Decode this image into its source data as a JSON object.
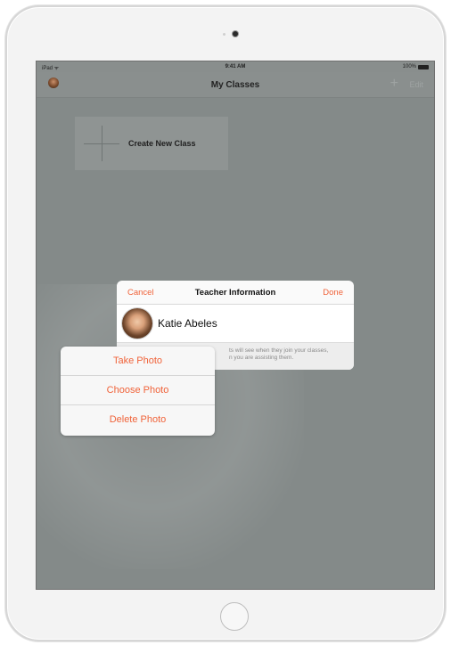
{
  "status_bar": {
    "carrier": "iPad ᯤ",
    "time": "9:41 AM",
    "battery": "100%"
  },
  "nav": {
    "title": "My Classes",
    "add_glyph": "+",
    "edit_label": "Edit"
  },
  "main": {
    "create_class_label": "Create New Class"
  },
  "dialog": {
    "cancel_label": "Cancel",
    "title": "Teacher Information",
    "done_label": "Done",
    "teacher_name": "Katie Abeles",
    "note_line1": "ts will see when they join your classes,",
    "note_line2": "n you are assisting them."
  },
  "action_sheet": {
    "items": [
      {
        "label": "Take Photo"
      },
      {
        "label": "Choose Photo"
      },
      {
        "label": "Delete Photo"
      }
    ]
  },
  "colors": {
    "accent": "#f0633a",
    "dim_overlay": "#848a89"
  }
}
